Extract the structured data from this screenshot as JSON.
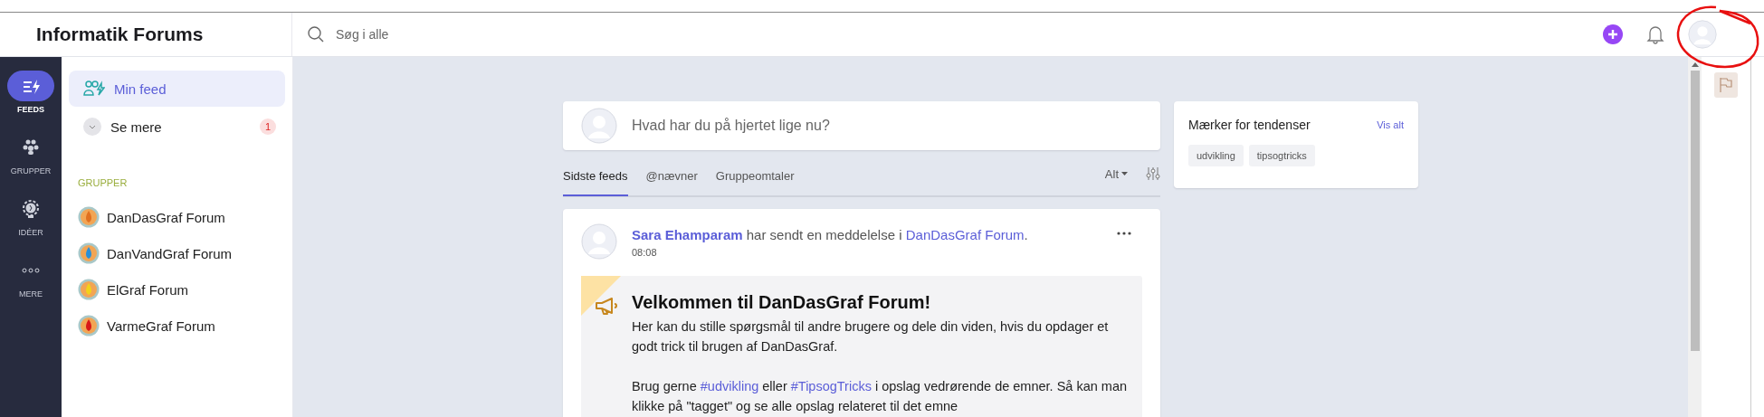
{
  "app": {
    "title": "Informatik Forums"
  },
  "search": {
    "placeholder": "Søg i alle"
  },
  "rail": [
    {
      "kind": "feeds",
      "label": "FEEDS",
      "selected": true
    },
    {
      "kind": "groups",
      "label": "GRUPPER",
      "selected": false
    },
    {
      "kind": "ideas",
      "label": "IDÉER",
      "selected": false
    },
    {
      "kind": "more",
      "label": "MERE",
      "selected": false
    }
  ],
  "sidebar": {
    "items": [
      {
        "kind": "feed",
        "label": "Min feed",
        "selected": true
      },
      {
        "kind": "more",
        "label": "Se mere",
        "selected": false,
        "badge": "1"
      }
    ],
    "section_title": "GRUPPER",
    "groups": [
      {
        "name": "DanDasGraf Forum",
        "color": "#e07020"
      },
      {
        "name": "DanVandGraf Forum",
        "color": "#2a8fd8"
      },
      {
        "name": "ElGraf Forum",
        "color": "#f2d21a"
      },
      {
        "name": "VarmeGraf Forum",
        "color": "#d81818"
      }
    ]
  },
  "composer": {
    "placeholder": "Hvad har du på hjertet lige nu?"
  },
  "feed_tabs": [
    {
      "label": "Sidste feeds",
      "selected": true
    },
    {
      "label": "@nævner",
      "selected": false
    },
    {
      "label": "Gruppeomtaler",
      "selected": false
    }
  ],
  "filter": {
    "label": "Alt"
  },
  "post": {
    "headline": [
      {
        "kind": "author",
        "text": "Sara Ehamparam"
      },
      {
        "kind": "text",
        "text": " har sendt en meddelelse i "
      },
      {
        "kind": "link",
        "text": "DanDasGraf Forum"
      },
      {
        "kind": "text",
        "text": "."
      }
    ],
    "time": "08:08",
    "announcement": {
      "title": "Velkommen til DanDasGraf Forum!",
      "paragraphs": [
        [
          {
            "kind": "text",
            "text": "Her kan du stille spørgsmål til andre brugere og dele din viden, hvis du opdager et godt trick til brugen af DanDasGraf."
          }
        ],
        [
          {
            "kind": "text",
            "text": "Brug gerne "
          },
          {
            "kind": "link",
            "text": "#udvikling"
          },
          {
            "kind": "text",
            "text": " eller "
          },
          {
            "kind": "link",
            "text": "#TipsogTricks"
          },
          {
            "kind": "text",
            "text": " i opslag vedrørende de emner. Så kan man klikke på \"tagget\" og se alle opslag relateret til det emne"
          }
        ]
      ]
    }
  },
  "trends": {
    "title": "Mærker for tendenser",
    "link": "Vis alt",
    "tags": [
      "udvikling",
      "tipsogtricks"
    ]
  }
}
